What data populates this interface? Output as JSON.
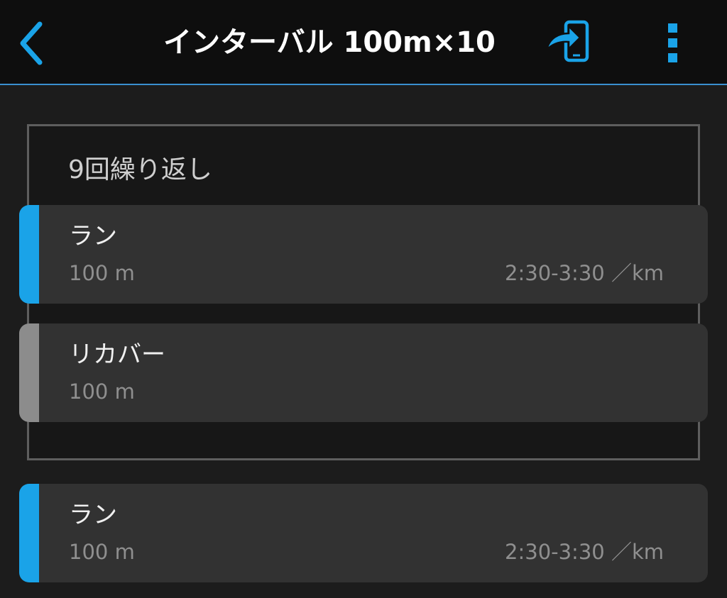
{
  "header": {
    "title": "インターバル 100m×10",
    "back_icon": "chevron-left-icon",
    "send_icon": "send-to-device-icon",
    "menu_icon": "more-vertical-icon"
  },
  "repeat_group": {
    "label": "9回繰り返し",
    "steps": [
      {
        "name": "ラン",
        "distance": "100 m",
        "pace": "2:30-3:30 ／km",
        "color": "#1aa3e8"
      },
      {
        "name": "リカバー",
        "distance": "100 m",
        "pace": "",
        "color": "#8c8c8c"
      }
    ]
  },
  "final_step": {
    "name": "ラン",
    "distance": "100 m",
    "pace": "2:30-3:30 ／km",
    "color": "#1aa3e8"
  },
  "colors": {
    "accent": "#1aa3e8",
    "header_bg": "#0e0e0e",
    "background": "#1c1c1c",
    "card_bg": "#323232"
  }
}
